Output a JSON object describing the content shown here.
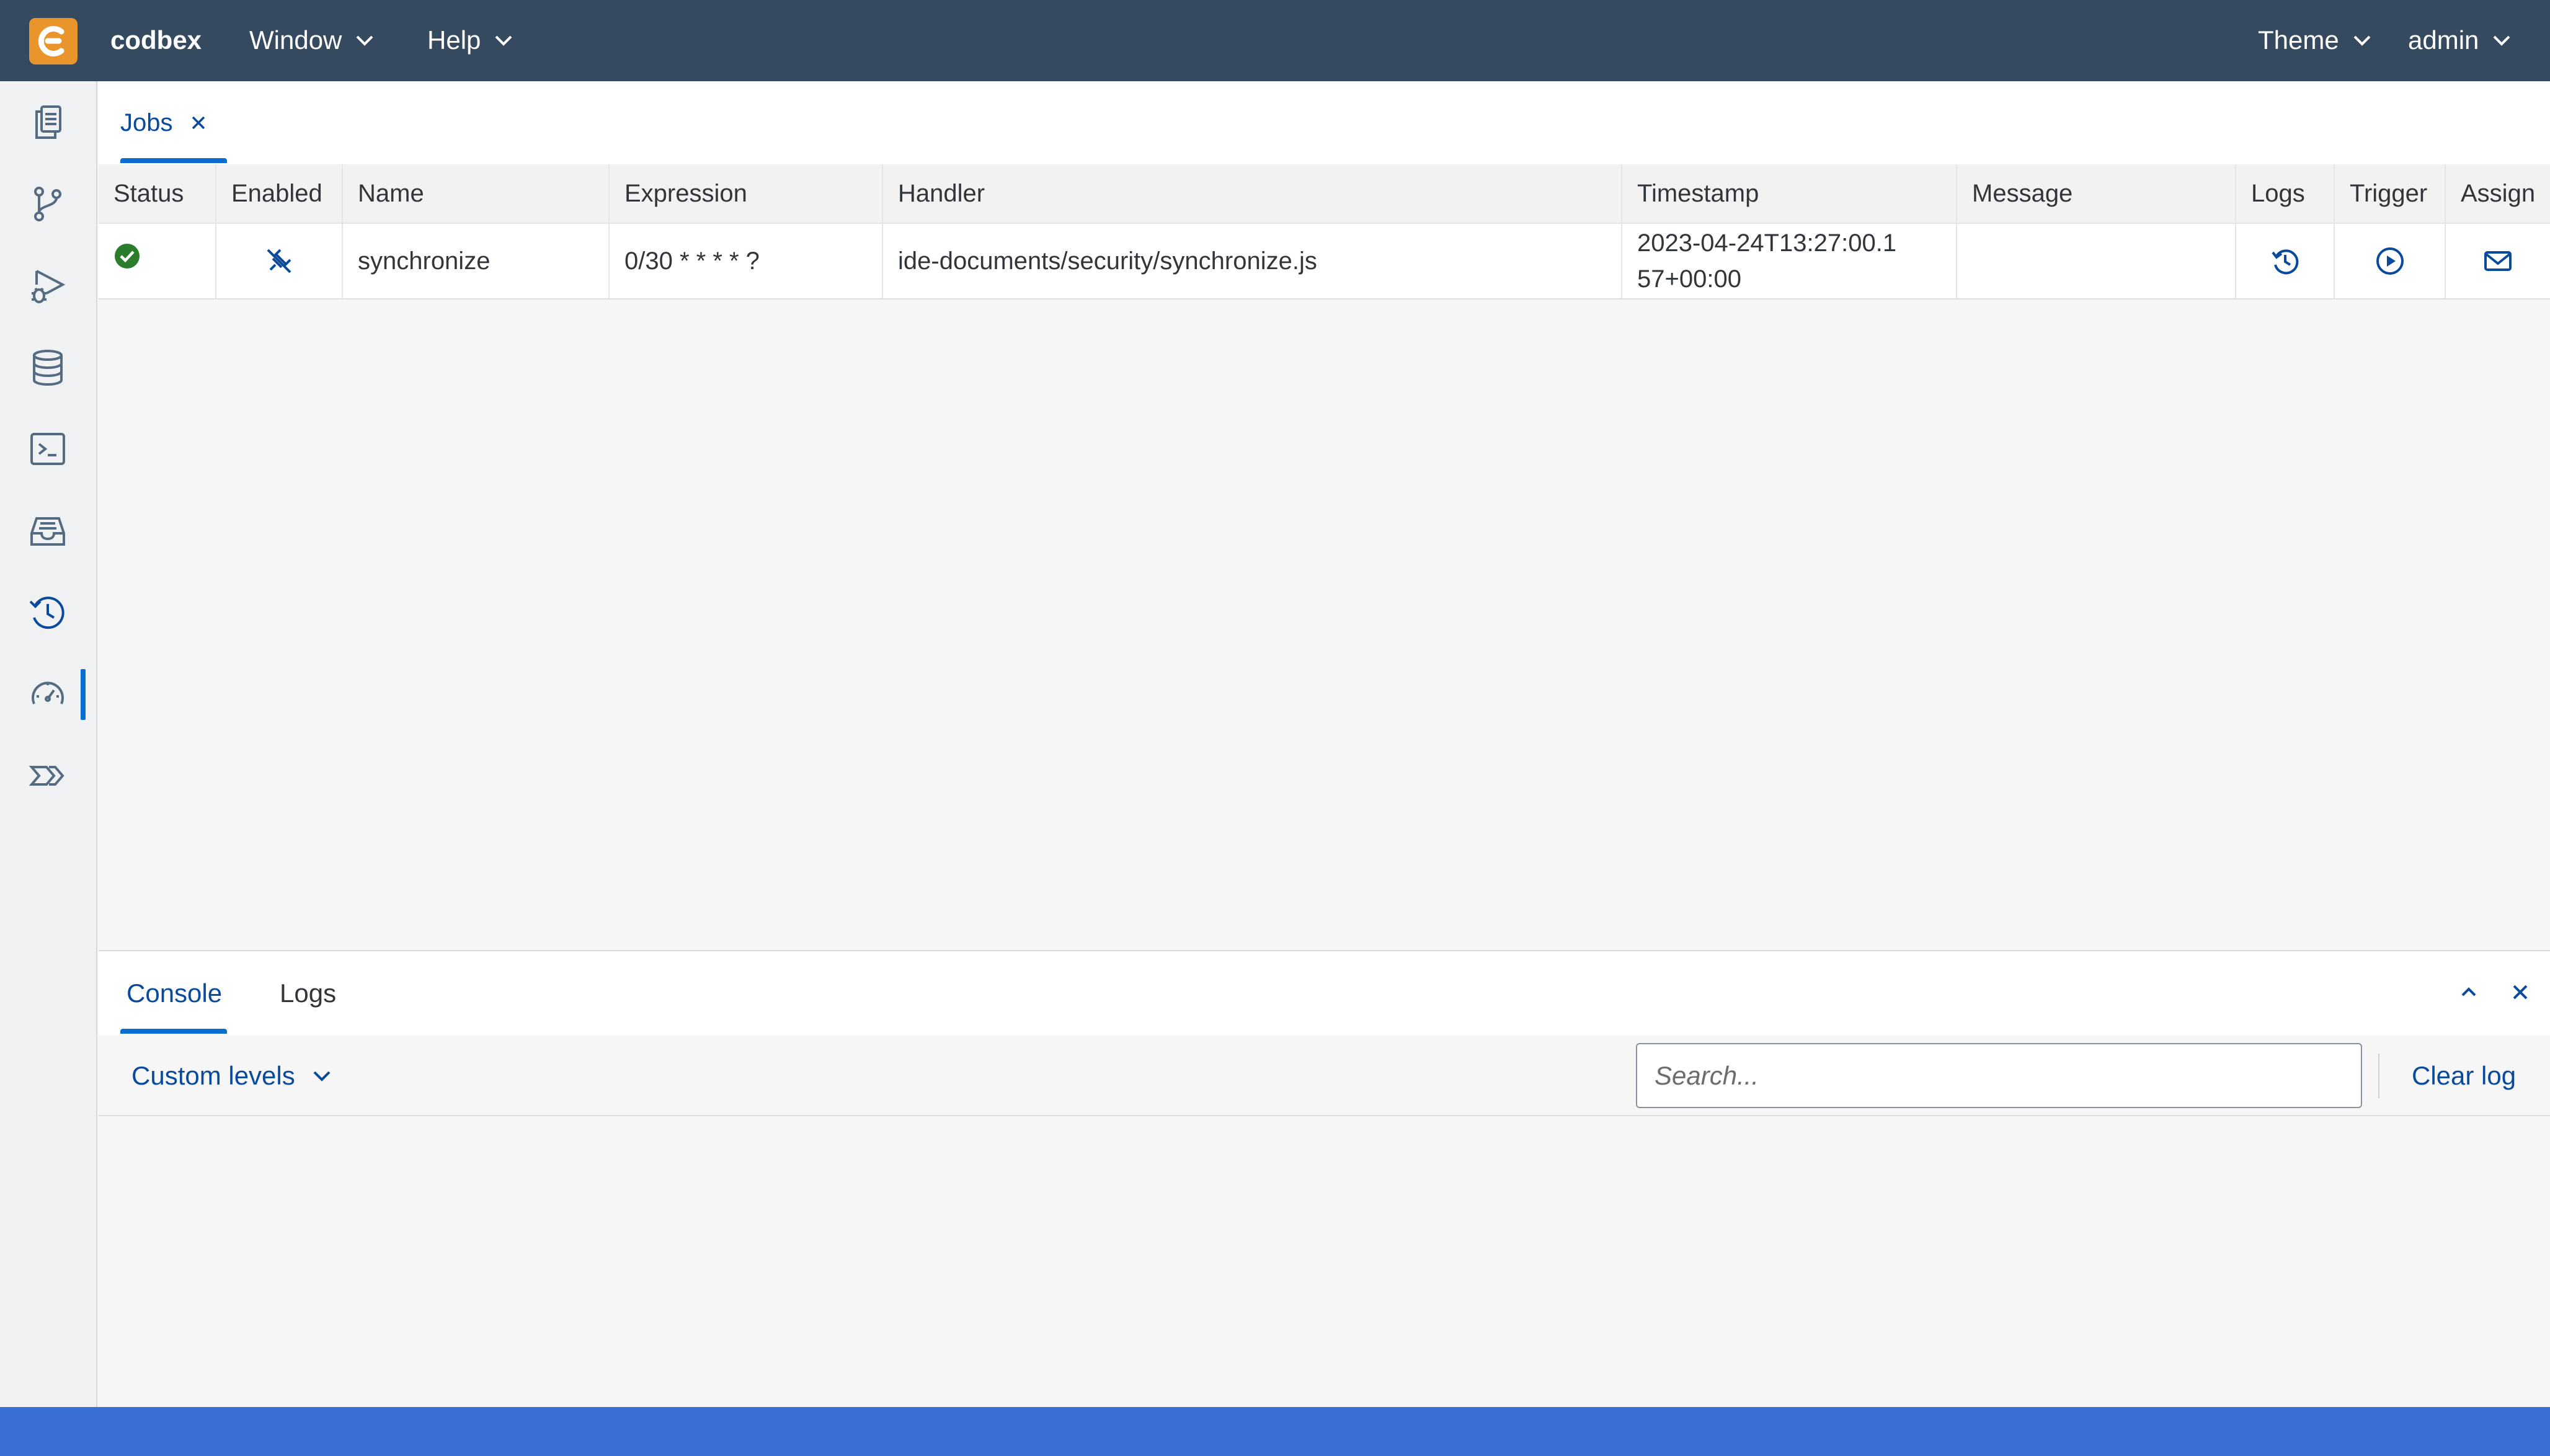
{
  "shell": {
    "brand": "codbex",
    "menus": [
      {
        "label": "Window"
      },
      {
        "label": "Help"
      }
    ],
    "theme_label": "Theme",
    "user_label": "admin"
  },
  "activity_bar": {
    "items": [
      {
        "name": "projects",
        "icon": "documents-icon"
      },
      {
        "name": "git",
        "icon": "git-branch-icon"
      },
      {
        "name": "debugger",
        "icon": "debug-run-icon"
      },
      {
        "name": "database",
        "icon": "database-icon"
      },
      {
        "name": "terminal",
        "icon": "terminal-icon"
      },
      {
        "name": "inbox",
        "icon": "inbox-tray-icon"
      },
      {
        "name": "jobs",
        "icon": "history-clock-icon",
        "active": true
      },
      {
        "name": "monitoring",
        "icon": "gauge-icon"
      },
      {
        "name": "processes",
        "icon": "chevrons-icon"
      }
    ]
  },
  "editor": {
    "tabs": [
      {
        "label": "Jobs",
        "active": true
      }
    ]
  },
  "jobs_table": {
    "columns": [
      "Status",
      "Enabled",
      "Name",
      "Expression",
      "Handler",
      "Timestamp",
      "Message",
      "Logs",
      "Trigger",
      "Assign"
    ],
    "rows": [
      {
        "status": "success",
        "enabled": "unlinked",
        "name": "synchronize",
        "expression": "0/30 * * * * ?",
        "handler": "ide-documents/security/synchronize.js",
        "timestamp": "2023-04-24T13:27:00.157+00:00",
        "message": ""
      }
    ]
  },
  "bottom_panel": {
    "tabs": [
      {
        "label": "Console",
        "active": true
      },
      {
        "label": "Logs",
        "active": false
      }
    ],
    "levels_label": "Custom levels",
    "search_placeholder": "Search...",
    "clear_label": "Clear log"
  },
  "colors": {
    "shellbar": "#354a5f",
    "accent": "#0a6ed1",
    "logo": "#e9952b",
    "success": "#2b7d2b",
    "statusbar": "#3a6fd3"
  }
}
